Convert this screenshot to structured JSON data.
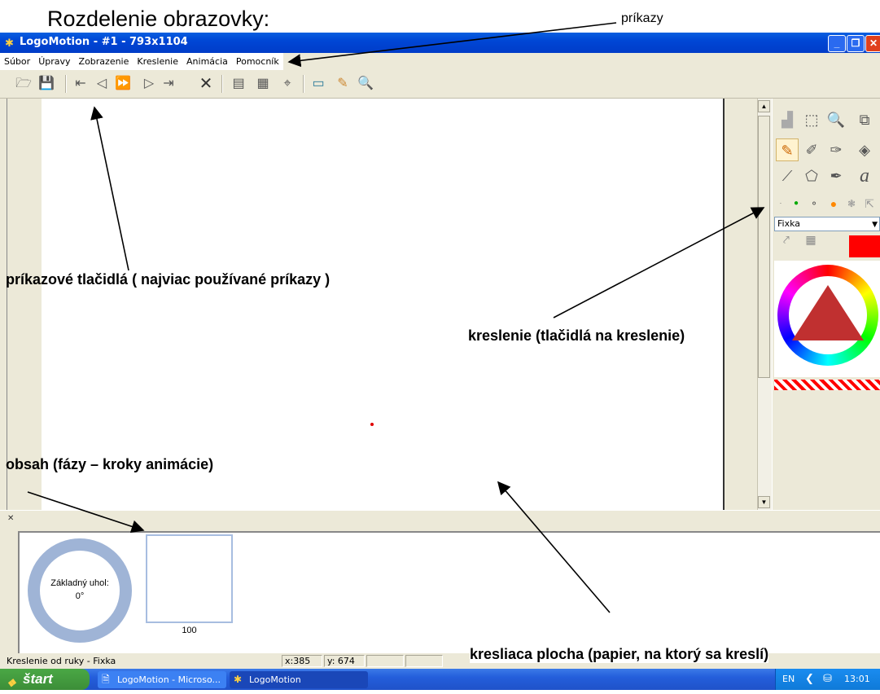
{
  "heading": "Rozdelenie obrazovky:",
  "window": {
    "title": "LogoMotion - #1 - 793x1104"
  },
  "menu": [
    "Súbor",
    "Úpravy",
    "Zobrazenie",
    "Kreslenie",
    "Animácia",
    "Pomocník"
  ],
  "toolbar_icons": [
    "open-icon",
    "save-icon",
    "first-frame-icon",
    "prev-frame-icon",
    "play-icon",
    "next-frame-icon",
    "last-frame-icon",
    "delete-icon",
    "size-icon",
    "preview-icon",
    "transform-icon",
    "properties-icon",
    "pen-color-icon",
    "zoom-icon"
  ],
  "tools": [
    "stairs-icon",
    "select-icon",
    "zoom-icon",
    "copy-icon",
    "pencil-icon",
    "brush-icon",
    "pen-icon",
    "fill-icon",
    "line-icon",
    "polygon-icon",
    "marker-icon",
    "text-icon"
  ],
  "brush_select": "Fixka",
  "frames": {
    "base_angle_label": "Základný uhol:",
    "base_angle_value": "0°",
    "frame_number": "100"
  },
  "status": {
    "text": "Kreslenie od ruky - Fixka",
    "x": "x:385",
    "y": "y: 674"
  },
  "taskbar": {
    "start": "štart",
    "tasks": [
      "LogoMotion - Microso...",
      "LogoMotion"
    ],
    "lang": "EN",
    "clock": "13:01"
  },
  "annotations": {
    "prikazy": "príkazy",
    "buttons": "príkazové tlačidlá ( najviac používané príkazy )",
    "drawing": "kreslenie (tlačidlá na kreslenie)",
    "content": "obsah (fázy – kroky animácie)",
    "canvas": "kresliaca plocha (papier, na ktorý sa kreslí)"
  },
  "colors": {
    "accent": "#0046d5",
    "pen_color": "#ff0000",
    "ring": "#9fb4d6"
  }
}
